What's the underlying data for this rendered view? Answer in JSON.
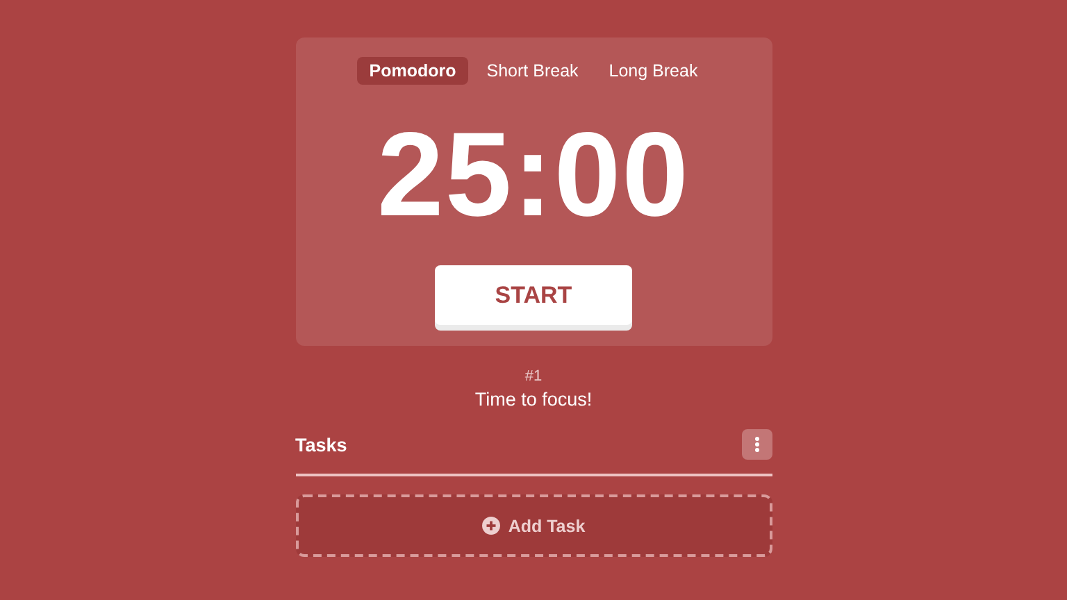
{
  "tabs": [
    {
      "label": "Pomodoro",
      "selected": true
    },
    {
      "label": "Short Break",
      "selected": false
    },
    {
      "label": "Long Break",
      "selected": false
    }
  ],
  "timer": "25:00",
  "start_button": "START",
  "session": {
    "count": "#1",
    "message": "Time to focus!"
  },
  "tasks": {
    "title": "Tasks",
    "add_button": "Add Task"
  }
}
